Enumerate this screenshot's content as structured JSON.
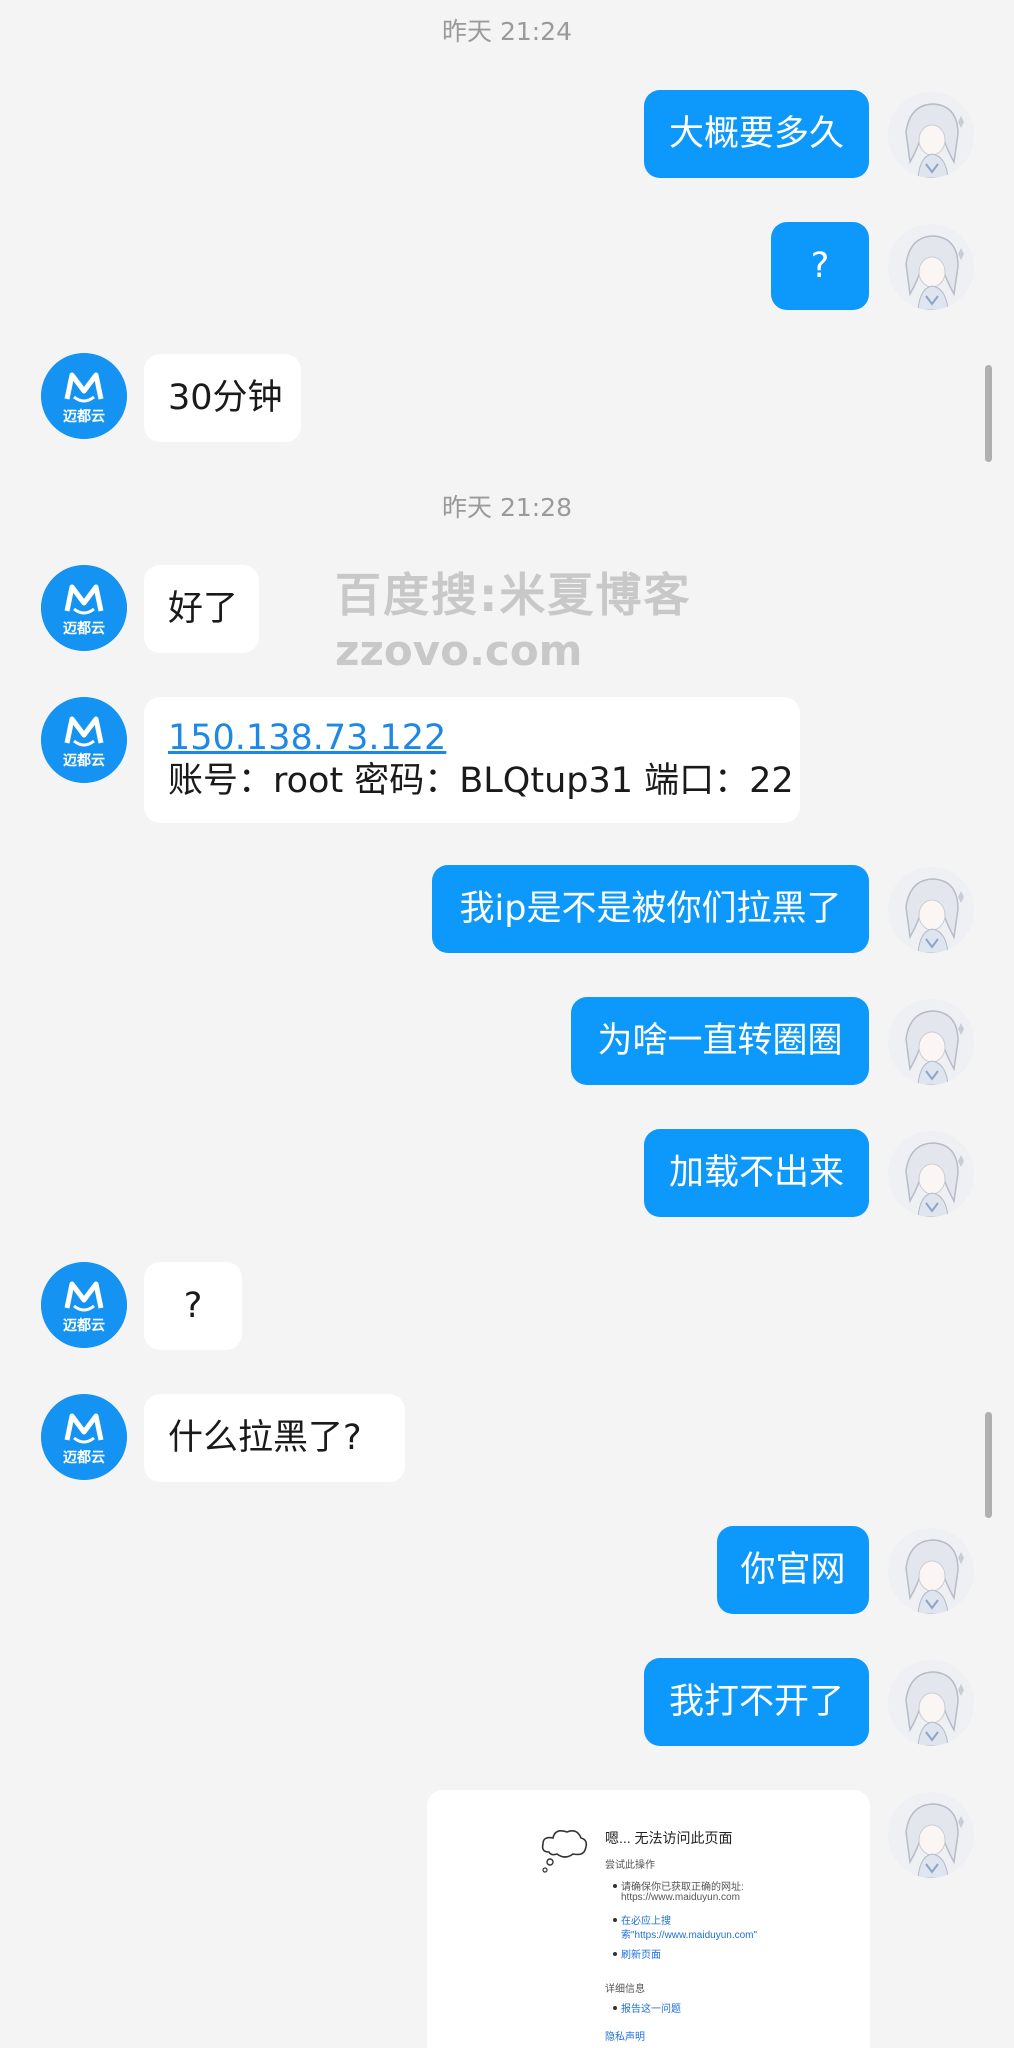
{
  "timestamps": [
    "昨天 21:24",
    "昨天 21:28"
  ],
  "messages": {
    "m1": "大概要多久",
    "m2": "?",
    "m3": "30分钟",
    "m4": "好了",
    "m5_link": "150.138.73.122",
    "m5_text": "账号：root 密码：BLQtup31 端口：22",
    "m6": "我ip是不是被你们拉黑了",
    "m7": "为啥一直转圈圈",
    "m8": "加载不出来",
    "m9": "?",
    "m10": "什么拉黑了?",
    "m11": "你官网",
    "m12": "我打不开了"
  },
  "bot_avatar": {
    "letter": "M",
    "label": "迈都云"
  },
  "watermark": {
    "line1": "百度搜:米夏博客",
    "line2": "zzovo.com"
  },
  "screenshot": {
    "title": "嗯... 无法访问此页面",
    "subtitle": "尝试此操作",
    "item1a": "请确保你已获取正确的网址:",
    "item1b": "https://www.maiduyun.com",
    "item2a": "在必应上搜",
    "item2b": "索\"https://www.maiduyun.com\"",
    "item3": "刷新页面",
    "details": "详细信息",
    "item4": "报告这一问题",
    "privacy": "隐私声明"
  },
  "colors": {
    "outgoing_bubble": "#0d99fb",
    "incoming_bubble": "#ffffff",
    "background": "#f4f4f4"
  }
}
